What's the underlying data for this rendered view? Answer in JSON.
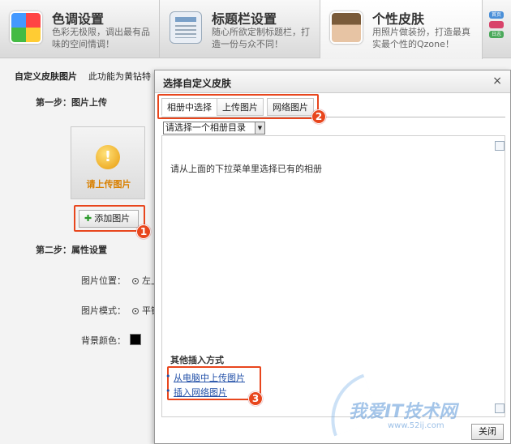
{
  "header": {
    "tabs": [
      {
        "title": "色调设置",
        "desc": "色彩无极限，调出最有品味的空间情调！",
        "icon": "palette-icon"
      },
      {
        "title": "标题栏设置",
        "desc": "随心所欲定制标题栏，打造一份与众不同！",
        "icon": "document-icon"
      },
      {
        "title": "个性皮肤",
        "desc": "用照片做装扮，打造最真实最个性的Qzone！",
        "icon": "photo-icon"
      }
    ],
    "edge_badges": [
      "首页",
      "",
      "日志"
    ]
  },
  "left": {
    "subbar_title": "自定义皮肤图片",
    "subbar_note": "此功能为黄钻特",
    "step1": "第一步：图片上传",
    "upload_placeholder": "请上传图片",
    "add_button": "添加图片",
    "step2": "第二步：属性设置",
    "props": [
      {
        "label": "图片位置：",
        "value": "左上"
      },
      {
        "label": "图片模式：",
        "value": "平铺"
      },
      {
        "label": "背景颜色：",
        "value": ""
      }
    ],
    "bg_color": "#000000"
  },
  "dialog": {
    "title": "选择自定义皮肤",
    "close_glyph": "×",
    "tabs": [
      "相册中选择",
      "上传图片",
      "网络图片"
    ],
    "select_value": "请选择一个相册目录",
    "hint": "请从上面的下拉菜单里选择已有的相册",
    "other_title": "其他插入方式",
    "links": [
      "从电脑中上传图片",
      "插入网络图片"
    ],
    "close_button": "关闭"
  },
  "annotations": [
    "1",
    "2",
    "3"
  ],
  "watermark": {
    "text": "我爱IT技术网",
    "url": "www.52ij.com"
  },
  "accent": "#e8461d"
}
